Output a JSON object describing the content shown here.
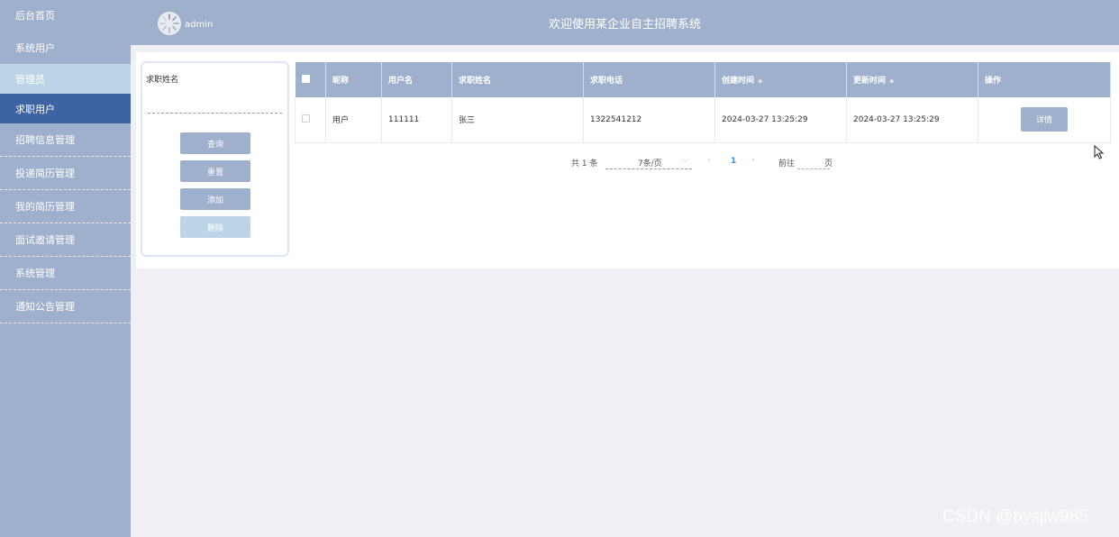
{
  "sidebar": {
    "items": [
      {
        "label": "后台首页"
      },
      {
        "label": "系统用户"
      },
      {
        "label": "管理员"
      },
      {
        "label": "求职用户"
      },
      {
        "label": "招聘信息管理"
      },
      {
        "label": "投递简历管理"
      },
      {
        "label": "我的简历管理"
      },
      {
        "label": "面试邀请管理"
      },
      {
        "label": "系统管理"
      },
      {
        "label": "通知公告管理"
      }
    ]
  },
  "header": {
    "username": "admin",
    "title": "欢迎使用某企业自主招聘系统"
  },
  "search": {
    "label": "求职姓名",
    "value": "",
    "buttons": {
      "query": "查询",
      "reset": "重置",
      "add": "添加",
      "delete": "删除"
    }
  },
  "table": {
    "columns": [
      "昵称",
      "用户名",
      "求职姓名",
      "求职电话",
      "创建时间",
      "更新时间",
      "操作"
    ],
    "rows": [
      {
        "nickname": "用户",
        "username": "111111",
        "name": "张三",
        "phone": "1322541212",
        "created": "2024-03-27 13:25:29",
        "updated": "2024-03-27 13:25:29",
        "action": "详情"
      }
    ]
  },
  "pagination": {
    "total": "共 1 条",
    "page_size": "7条/页",
    "current_page": "1",
    "goto_label": "前往",
    "page_suffix": "页"
  },
  "watermark": "CSDN @bysjlw985",
  "colors": {
    "primary": "#9eb0cc",
    "active": "#3d63a3",
    "light": "#bcd4e6",
    "background": "#efeff4"
  }
}
